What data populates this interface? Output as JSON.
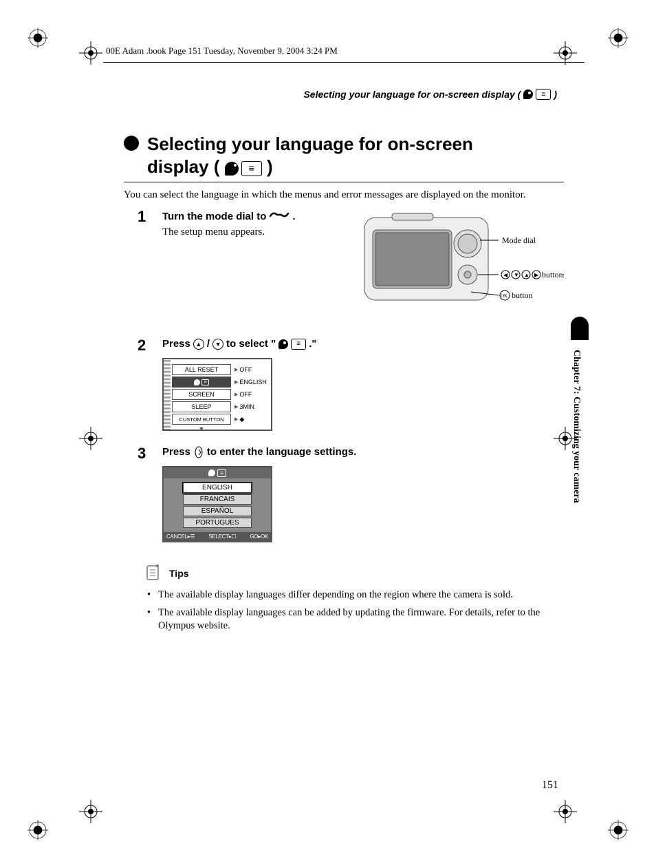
{
  "print_header": "00E Adam .book  Page 151  Tuesday, November 9, 2004  3:24 PM",
  "running_head": "Selecting your language for on-screen display (",
  "running_head_close": ")",
  "heading_line1": "Selecting your language for on-screen",
  "heading_line2_prefix": "display (",
  "heading_line2_suffix": ")",
  "intro": "You can select the language in which the menus and error messages are displayed on the monitor.",
  "steps": [
    {
      "num": "1",
      "title_before": "Turn the mode dial to ",
      "title_after": ".",
      "desc": "The setup menu appears."
    },
    {
      "num": "2",
      "title_before": "Press ",
      "title_mid": "/",
      "title_after": " to select \"",
      "title_close": ".\""
    },
    {
      "num": "3",
      "title_before": "Press ",
      "title_after": " to enter the language settings."
    }
  ],
  "camera_labels": {
    "mode_dial": "Mode dial",
    "arrow_buttons": " buttons",
    "ok_button": " button"
  },
  "setup_menu": {
    "rows": [
      {
        "label": "ALL RESET",
        "value": "OFF",
        "dark": false
      },
      {
        "label": "",
        "value": "ENGLISH",
        "dark": true,
        "icon": true
      },
      {
        "label": "SCREEN",
        "value": "OFF",
        "dark": false
      },
      {
        "label": "SLEEP",
        "value": "3MIN",
        "dark": false
      },
      {
        "label": "CUSTOM BUTTON",
        "value": "",
        "dark": false,
        "icon_val": true
      }
    ]
  },
  "lang_menu": {
    "items": [
      "ENGLISH",
      "FRANCAIS",
      "ESPAÑOL",
      "PORTUGUES"
    ],
    "selected_index": 0,
    "footer": {
      "cancel": "CANCEL▸☰",
      "select": "SELECT▸☐",
      "go": "GO▸OK"
    }
  },
  "tips_label": "Tips",
  "tips": [
    "The available display languages differ depending on the region where the camera is sold.",
    "The available display languages can be added by updating the firmware. For details, refer to the Olympus website."
  ],
  "side_tab": "Chapter 7: Customizing your camera",
  "page_number": "151"
}
